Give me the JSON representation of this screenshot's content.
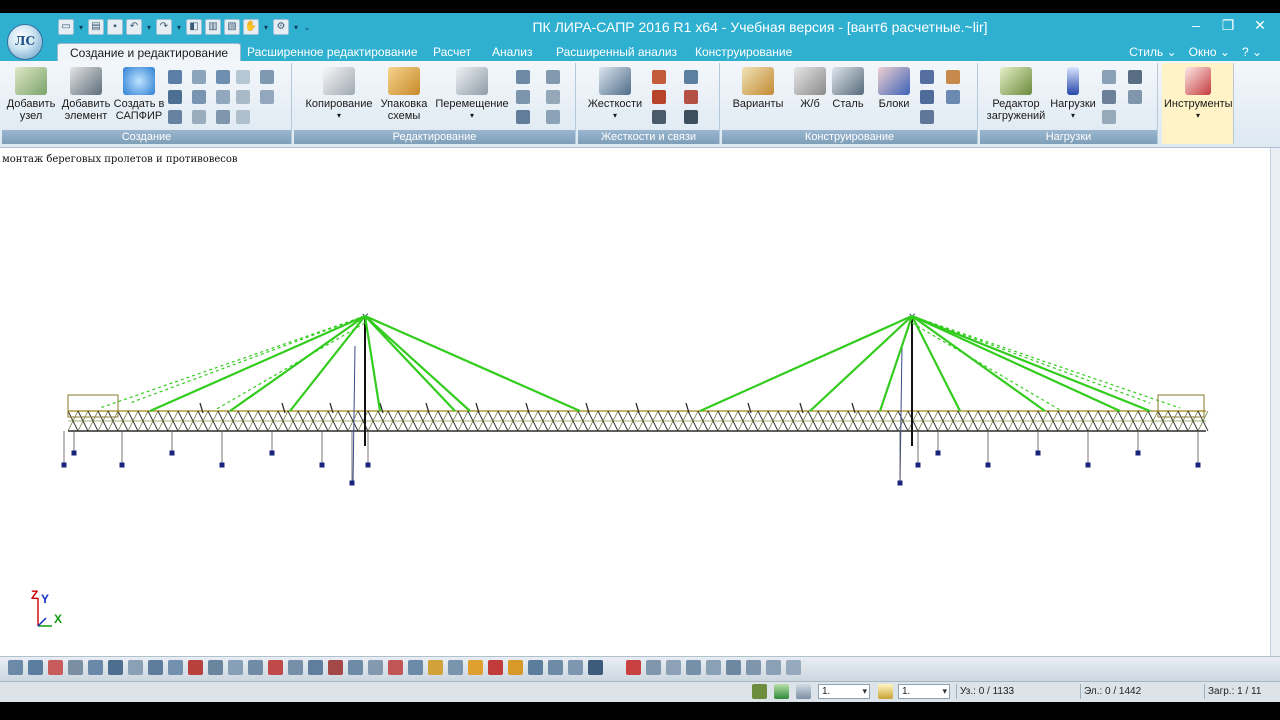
{
  "window": {
    "title": "ПК ЛИРА-САПР  2016 R1 x64 - Учебная версия - [вант6 расчетные.~lir]",
    "controls": [
      "–",
      "❐",
      "✕"
    ]
  },
  "tabs": [
    "Создание и редактирование",
    "Расширенное редактирование",
    "Расчет",
    "Анализ",
    "Расширенный анализ",
    "Конструирование"
  ],
  "right_menu": [
    "Стиль ⌄",
    "Окно ⌄",
    "? ⌄"
  ],
  "ribbon": {
    "groups": {
      "creation": "Создание",
      "editing": "Редактирование",
      "stiffness": "Жесткости и связи",
      "design": "Конструирование",
      "loads": "Нагрузки"
    },
    "buttons": {
      "add_node": "Добавить\nузел",
      "add_element": "Добавить\nэлемент",
      "create_sapfir": "Создать в\nСАПФИР",
      "copy": "Копирование",
      "pack": "Упаковка\nсхемы",
      "move": "Перемещение",
      "stiffness": "Жесткости",
      "variants": "Варианты",
      "rc": "Ж/б",
      "steel": "Сталь",
      "blocks": "Блоки",
      "load_editor": "Редактор\nзагружений",
      "loads": "Нагрузки",
      "tools": "Инструменты"
    },
    "icons": {
      "add_node": "xyz-node-icon",
      "add_element": "add-element-icon",
      "create_sapfir": "sapfir-icon",
      "copy": "copy-icon",
      "pack": "pack-icon",
      "move": "move-icon",
      "stiffness": "stiffness-icon",
      "variants": "hammer-icon",
      "rc": "rc-block-icon",
      "steel": "steel-beam-icon",
      "blocks": "blocks-icon",
      "load_editor": "load-editor-icon",
      "loads": "load-arrow-icon",
      "tools": "tools-icon"
    }
  },
  "canvas": {
    "note": "монтаж береговых пролетов и противовесов",
    "axes": {
      "z": "Z",
      "y": "Y",
      "x": "X"
    },
    "colors": {
      "cable": "#33cc1e",
      "deck": "#2a2a2a",
      "pylon": "#111111",
      "support": "#1a237e",
      "background": "#ffffff"
    }
  },
  "statusbar": {
    "combo1": "1.",
    "combo2": "1.",
    "nodes": "Уз.: 0 / 1133",
    "elements": "Эл.: 0 / 1442",
    "loadcase": "Загр.: 1 / 11"
  }
}
